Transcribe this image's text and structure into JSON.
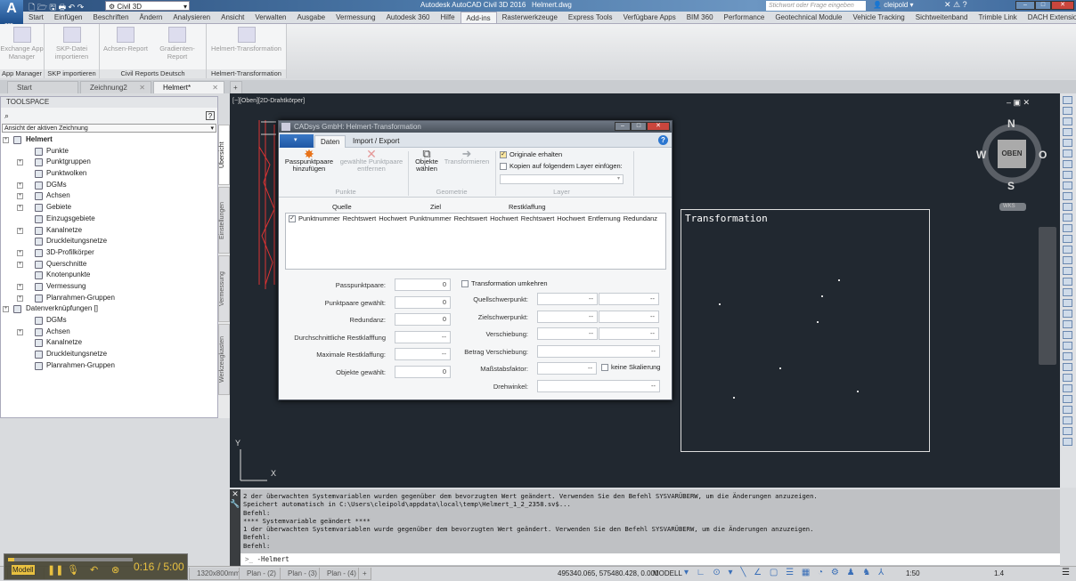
{
  "app": {
    "title": "Autodesk AutoCAD Civil 3D 2016",
    "file": "Helmert.dwg",
    "badge": "C3D",
    "workspace": "Civil 3D",
    "search_placeholder": "Stichwort oder Frage eingeben",
    "user": "cleipold"
  },
  "ribbon_tabs": [
    "Start",
    "Einfügen",
    "Beschriften",
    "Ändern",
    "Analysieren",
    "Ansicht",
    "Verwalten",
    "Ausgabe",
    "Vermessung",
    "Autodesk 360",
    "Hilfe",
    "Add-ins",
    "Rasterwerkzeuge",
    "Express Tools",
    "Verfügbare Apps",
    "BIM 360",
    "Performance",
    "Geotechnical Module",
    "Vehicle Tracking",
    "Sichtweitenband",
    "Trimble Link",
    "DACH Extension"
  ],
  "active_ribbon_tab": "Add-ins",
  "ribbon_groups": [
    {
      "label": "App Manager",
      "buttons": [
        "Exchange App Manager"
      ]
    },
    {
      "label": "SKP importieren",
      "buttons": [
        "SKP-Datei importieren"
      ]
    },
    {
      "label": "Civil Reports Deutsch",
      "buttons": [
        "Achsen-Report",
        "Gradienten-Report"
      ]
    },
    {
      "label": "Helmert-Transformation",
      "buttons": [
        "Helmert-Transformation"
      ]
    }
  ],
  "doc_tabs": [
    {
      "label": "Start"
    },
    {
      "label": "Zeichnung2"
    },
    {
      "label": "Helmert*"
    }
  ],
  "toolspace": {
    "title": "TOOLSPACE",
    "view": "Ansicht der aktiven Zeichnung",
    "tree": [
      {
        "label": "Helmert",
        "level": 0,
        "exp": true,
        "bold": true
      },
      {
        "label": "Punkte",
        "level": 1
      },
      {
        "label": "Punktgruppen",
        "level": 1,
        "exp": true
      },
      {
        "label": "Punktwolken",
        "level": 1
      },
      {
        "label": "DGMs",
        "level": 1,
        "exp": true
      },
      {
        "label": "Achsen",
        "level": 1,
        "exp": true
      },
      {
        "label": "Gebiete",
        "level": 1,
        "exp": true
      },
      {
        "label": "Einzugsgebiete",
        "level": 1
      },
      {
        "label": "Kanalnetze",
        "level": 1,
        "exp": true
      },
      {
        "label": "Druckleitungsnetze",
        "level": 1
      },
      {
        "label": "3D-Profilkörper",
        "level": 1,
        "exp": true
      },
      {
        "label": "Querschnitte",
        "level": 1,
        "exp": true
      },
      {
        "label": "Knotenpunkte",
        "level": 1
      },
      {
        "label": "Vermessung",
        "level": 1,
        "exp": true
      },
      {
        "label": "Planrahmen-Gruppen",
        "level": 1,
        "exp": true
      },
      {
        "label": "Datenverknüpfungen []",
        "level": 0,
        "exp": true
      },
      {
        "label": "DGMs",
        "level": 1
      },
      {
        "label": "Achsen",
        "level": 1,
        "exp": true
      },
      {
        "label": "Kanalnetze",
        "level": 1
      },
      {
        "label": "Druckleitungsnetze",
        "level": 1
      },
      {
        "label": "Planrahmen-Gruppen",
        "level": 1
      }
    ],
    "side_tabs": [
      "Übersicht",
      "Einstellungen",
      "Vermessung",
      "Werkzeugkasten"
    ]
  },
  "viewport": {
    "label": "[−][Oben][2D-Drahtkörper]",
    "viewcube": {
      "top": "OBEN",
      "n": "N",
      "s": "S",
      "w": "W",
      "e": "O",
      "ucs": "WKS"
    },
    "frame_title": "Transformation",
    "axis_x": "X",
    "axis_y": "Y"
  },
  "dialog": {
    "title": "CADsys GmbH: Helmert-Transformation",
    "tabs": [
      "Daten",
      "Import / Export"
    ],
    "buttons": {
      "add": "Passpunktpaare hinzufügen",
      "remove": "gewählte Punktpaare entfernen",
      "select": "Objekte wählen",
      "transform": "Transformieren"
    },
    "groups": {
      "points": "Punkte",
      "geometry": "Geometrie",
      "layer": "Layer"
    },
    "keep_originals": "Originale erhalten",
    "copy_to_layer": "Kopien auf folgendem Layer einfügen:",
    "col_groups": [
      "Quelle",
      "Ziel",
      "Restklaffung"
    ],
    "columns": [
      "Punktnummer",
      "Rechtswert",
      "Hochwert",
      "Punktnummer",
      "Rechtswert",
      "Hochwert",
      "Rechtswert",
      "Hochwert",
      "Entfernung",
      "Redundanz"
    ],
    "left_fields": [
      {
        "label": "Passpunktpaare:",
        "value": "0"
      },
      {
        "label": "Punktpaare gewählt:",
        "value": "0"
      },
      {
        "label": "Redundanz:",
        "value": "0"
      },
      {
        "label": "Durchschnittliche Restklafffung",
        "value": "--"
      },
      {
        "label": "Maximale Restklaffung:",
        "value": "--"
      },
      {
        "label": "Objekte gewählt:",
        "value": "0"
      }
    ],
    "invert": "Transformation umkehren",
    "right_fields": [
      {
        "label": "Quellschwerpunkt:",
        "values": [
          "--",
          "--"
        ]
      },
      {
        "label": "Zielschwerpunkt:",
        "values": [
          "--",
          "--"
        ]
      },
      {
        "label": "Verschiebung:",
        "values": [
          "--",
          "--"
        ]
      },
      {
        "label": "Betrag Verschiebung:",
        "values": [
          "--"
        ]
      },
      {
        "label": "Maßstabsfaktor:",
        "values": [
          "--"
        ]
      },
      {
        "label": "Drehwinkel:",
        "values": [
          "--"
        ]
      }
    ],
    "no_scale": "keine Skalierung"
  },
  "command": {
    "history": [
      "2 der überwachten Systemvariablen wurden gegenüber dem bevorzugten Wert geändert. Verwenden Sie den Befehl SYSVARÜBERW, um die Änderungen anzuzeigen.",
      "Speichert automatisch in C:\\Users\\cleipold\\appdata\\local\\temp\\Helmert_1_2_2358.sv$...",
      "Befehl:",
      "**** Systemvariable geändert ****",
      "1 der überwachten Systemvariablen wurde gegenüber dem bevorzugten Wert geändert. Verwenden Sie den Befehl SYSVARÜBERW, um die Änderungen anzuzeigen.",
      "Befehl:",
      "Befehl:"
    ],
    "input": "-Helmert",
    "prompt": ">_"
  },
  "layout_tabs": [
    "Modell",
    "1320x800mm",
    "Plan - (2)",
    "Plan - (3)",
    "Plan - (4)",
    "+"
  ],
  "status": {
    "coords": "495340.065, 575480.428, 0.000",
    "space": "MODELL",
    "scale": "1:50",
    "annoscale": "1.4"
  },
  "recorder": {
    "time": "0:16 / 5:00",
    "progress": 0.053
  }
}
